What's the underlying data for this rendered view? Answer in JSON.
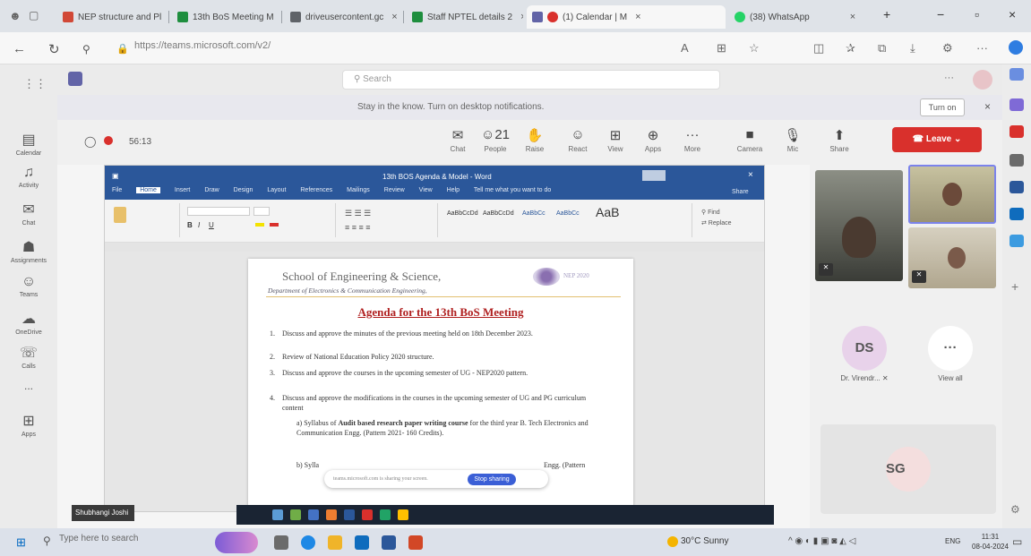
{
  "browser": {
    "tabs": [
      {
        "label": "NEP structure and Pl",
        "color": "#d14836"
      },
      {
        "label": "13th BoS Meeting M",
        "color": "#1e8e3e"
      },
      {
        "label": "driveusercontent.gc",
        "color": "#5f6368"
      },
      {
        "label": "Staff NPTEL details 2",
        "color": "#1e8e3e"
      },
      {
        "label": "(1) Calendar | M",
        "color": "#6264a7"
      },
      {
        "label": "(38) WhatsApp",
        "color": "#25d366"
      }
    ],
    "url": "https://teams.microsoft.com/v2/"
  },
  "teams": {
    "search_placeholder": "Search",
    "notification": "Stay in the know. Turn on desktop notifications.",
    "turn_on": "Turn on",
    "rail": [
      {
        "label": "Calendar",
        "icon": "calendar-icon",
        "glyph": "▤"
      },
      {
        "label": "Activity",
        "icon": "bell-icon",
        "glyph": "♫"
      },
      {
        "label": "Chat",
        "icon": "chat-icon",
        "glyph": "✉"
      },
      {
        "label": "Assignments",
        "icon": "assignments-icon",
        "glyph": "☗"
      },
      {
        "label": "Teams",
        "icon": "teams-icon",
        "glyph": "☺"
      },
      {
        "label": "OneDrive",
        "icon": "cloud-icon",
        "glyph": "☁"
      },
      {
        "label": "Calls",
        "icon": "phone-icon",
        "glyph": "☏"
      },
      {
        "label": "...",
        "icon": "more-icon",
        "glyph": ""
      },
      {
        "label": "Apps",
        "icon": "apps-icon",
        "glyph": "⊞"
      }
    ]
  },
  "meeting": {
    "timer": "56:13",
    "toolbar": [
      {
        "label": "Chat",
        "icon": "chat-icon",
        "glyph": "✉"
      },
      {
        "label": "People",
        "icon": "people-icon",
        "glyph": "☺21"
      },
      {
        "label": "Raise",
        "icon": "hand-icon",
        "glyph": "✋"
      },
      {
        "label": "React",
        "icon": "smile-icon",
        "glyph": "☺"
      },
      {
        "label": "View",
        "icon": "grid-icon",
        "glyph": "⊞"
      },
      {
        "label": "Apps",
        "icon": "apps-icon",
        "glyph": "⊕"
      },
      {
        "label": "More",
        "icon": "more-icon",
        "glyph": "···"
      },
      {
        "label": "Camera",
        "icon": "camera-icon",
        "glyph": "■"
      },
      {
        "label": "Mic",
        "icon": "mic-icon",
        "glyph": "🎙"
      },
      {
        "label": "Share",
        "icon": "share-icon",
        "glyph": "⬆"
      }
    ],
    "leave_label": "Leave",
    "presenter": "Shubhangi Joshi"
  },
  "word": {
    "title": "13th BOS Agenda & Model - Word",
    "tabs": [
      "File",
      "Home",
      "Insert",
      "Draw",
      "Design",
      "Layout",
      "References",
      "Mailings",
      "Review",
      "View",
      "Help",
      "Tell me what you want to do"
    ],
    "share": "Share",
    "styles": [
      "AaBbCcDd",
      "AaBbCcDd",
      "AaBbCc",
      "AaBbCc",
      "AaB"
    ]
  },
  "document": {
    "school": "School of Engineering & Science,",
    "department": "Department of Electronics & Communication Engineering,",
    "heading": "Agenda for the 13th BoS Meeting",
    "items": [
      {
        "n": "1.",
        "text": "Discuss and approve the minutes of the previous meeting held on 18th December 2023."
      },
      {
        "n": "2.",
        "text": "Review of National Education Policy 2020 structure."
      },
      {
        "n": "3.",
        "text": "Discuss and approve the courses in the upcoming semester of UG - NEP2020 pattern."
      },
      {
        "n": "4.",
        "text": "Discuss and approve the modifications in the courses in the upcoming semester of UG and PG curriculum content"
      }
    ],
    "sub_a_prefix": "a) Syllabus of",
    "sub_a_bold": "Audit based research paper writing course",
    "sub_a_rest": "for the third year B. Tech Electronics and Communication Engg. (Pattern 2021- 160 Credits).",
    "sub_b": "b) Sylla",
    "sub_b_tail": "Engg. (Pattern",
    "waiting_text": "teams.microsoft.com is sharing your screen.",
    "stop_sharing": "Stop sharing"
  },
  "participants": {
    "ds_initials": "DS",
    "ds_name": "Dr. Virendr...",
    "view_all": "View all",
    "sg_initials": "SG"
  },
  "taskbar": {
    "search_placeholder": "Type here to search",
    "weather": "30°C  Sunny",
    "language": "ENG",
    "time": "11:31",
    "date": "08-04-2024"
  }
}
